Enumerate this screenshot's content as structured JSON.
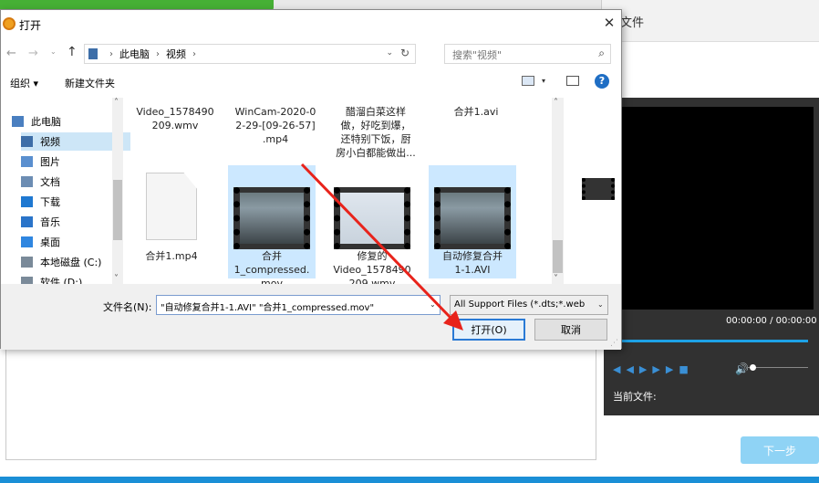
{
  "background_app": {
    "panel_title": "文件",
    "time_display": "00:00:00 / 00:00:00",
    "current_file_label": "当前文件:",
    "next_button": "下一步",
    "accent_color": "#1da1e6",
    "green_tab_color": "#46b035"
  },
  "dialog": {
    "title": "打开",
    "close_glyph": "✕",
    "nav": {
      "back": "←",
      "forward": "→",
      "recent": "⌄",
      "up": "↑"
    },
    "address": {
      "crumbs": [
        "此电脑",
        "视频"
      ],
      "separator": "›",
      "refresh_glyph": "↻",
      "dropdown_glyph": "⌄"
    },
    "search_placeholder": "搜索\"视频\"",
    "search_glyph": "⌕",
    "toolbar": {
      "organize": "组织 ▾",
      "new_folder": "新建文件夹",
      "view_dropdown": "▾",
      "help": "?"
    },
    "sidebar": {
      "items": [
        {
          "label": "此电脑",
          "icon": "pc-icon",
          "color": "#4a7fc0"
        },
        {
          "label": "视频",
          "icon": "video-folder-icon",
          "color": "#3d6ea8",
          "selected": true
        },
        {
          "label": "图片",
          "icon": "pictures-icon",
          "color": "#5a8fcf"
        },
        {
          "label": "文档",
          "icon": "documents-icon",
          "color": "#6c8db3"
        },
        {
          "label": "下载",
          "icon": "download-icon",
          "color": "#1f78d1"
        },
        {
          "label": "音乐",
          "icon": "music-icon",
          "color": "#2a74c9"
        },
        {
          "label": "桌面",
          "icon": "desktop-icon",
          "color": "#2f86e0"
        },
        {
          "label": "本地磁盘 (C:)",
          "icon": "drive-c-icon",
          "color": "#7a8a99"
        },
        {
          "label": "软件 (D:)",
          "icon": "drive-d-icon",
          "color": "#7a8a99"
        }
      ],
      "scroll_up": "˄",
      "scroll_down": "˅"
    },
    "files": {
      "row1": [
        {
          "name": "Video_1578490\n209.wmv"
        },
        {
          "name": "WinCam-2020-0\n2-29-[09-26-57]\n.mp4"
        },
        {
          "name": "醋溜白菜这样\n做，好吃到爆，\n还特别下饭，厨\n房小白都能做出..."
        },
        {
          "name": "合并1.avi"
        }
      ],
      "row2": [
        {
          "name": "合并1.mp4",
          "thumb": "document-icon",
          "selected": false
        },
        {
          "name": "合并\n1_compressed.\nmov",
          "thumb": "video-thumbnail-icon",
          "selected": true
        },
        {
          "name": "修复的\nVideo_1578490\n209.wmv",
          "thumb": "video-thumbnail-icon",
          "selected": false
        },
        {
          "name": "自动修复合并\n1-1.AVI",
          "thumb": "video-thumbnail-icon",
          "selected": true
        }
      ],
      "scroll_up": "˄",
      "scroll_down": "˅"
    },
    "filename_label": "文件名(N):",
    "filename_value": "\"自动修复合并1-1.AVI\" \"合并1_compressed.mov\"",
    "filetype_value": "All Support Files (*.dts;*.web",
    "open_button": "打开(O)",
    "cancel_button": "取消",
    "dropdown_glyph": "⌄",
    "selection_color": "#cce8ff"
  },
  "annotation": {
    "arrow_color": "#e8231b"
  }
}
